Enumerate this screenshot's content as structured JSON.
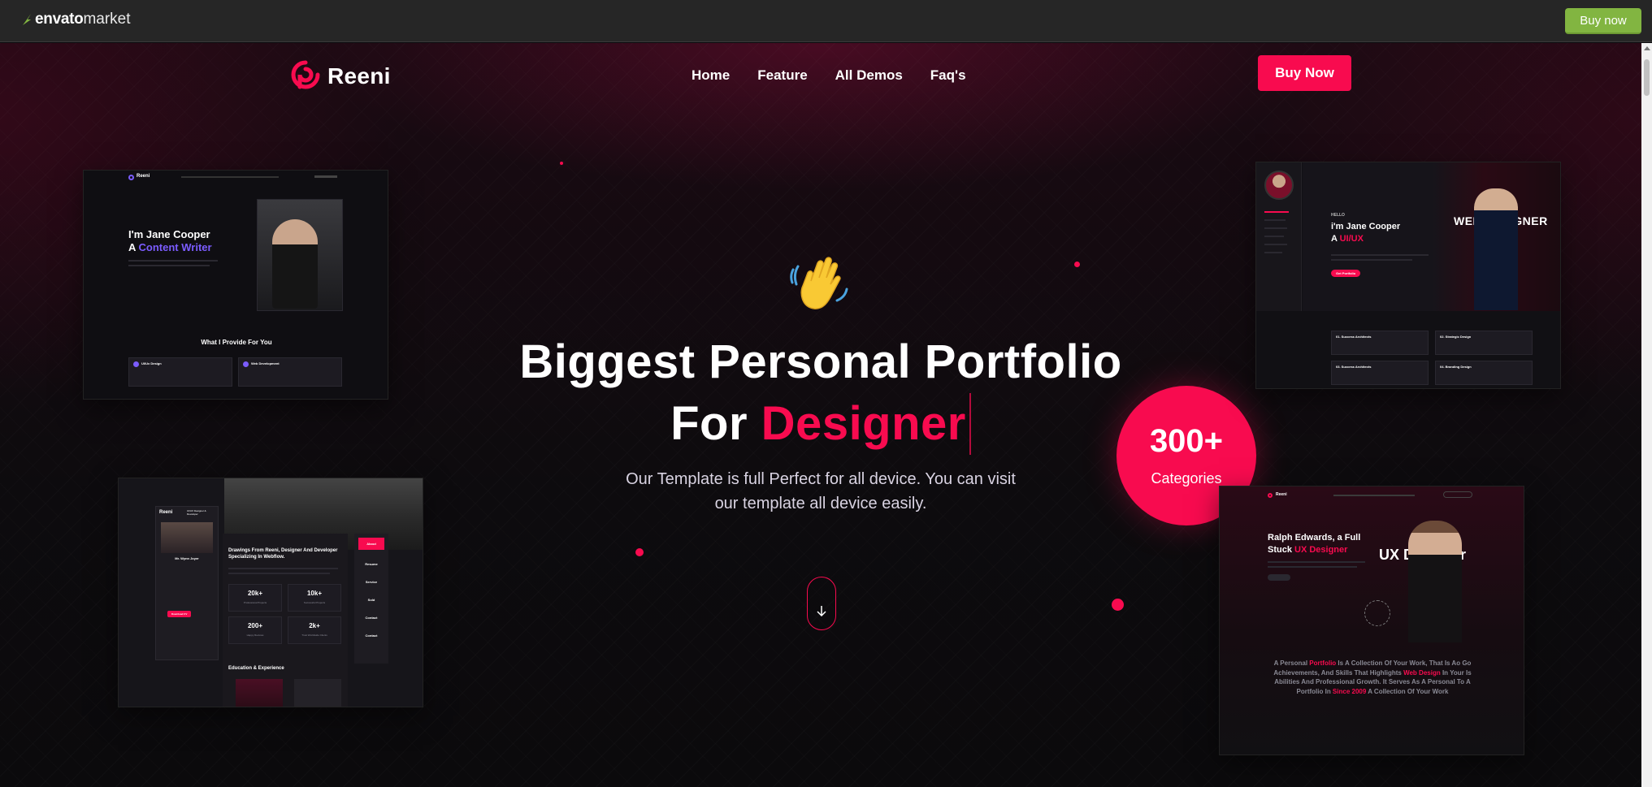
{
  "envato": {
    "logo_bold": "envato",
    "logo_light": "market",
    "buy_label": "Buy now"
  },
  "header": {
    "brand": "Reeni",
    "nav": [
      "Home",
      "Feature",
      "All Demos",
      "Faq's"
    ],
    "buy_label": "Buy Now"
  },
  "hero": {
    "title_line1": "Biggest Personal Portfolio",
    "title_line2_plain": "For ",
    "title_line2_accent": "Designer",
    "subtitle": "Our Template is full Perfect for all device. You can visit our template all device easily."
  },
  "badge": {
    "number": "300+",
    "label": "Categories"
  },
  "cards": {
    "card1": {
      "brand": "Reeni",
      "heading_plain": "I'm Jane Cooper",
      "heading_prefix": "A ",
      "heading_accent": "Content Writer",
      "section_title": "What I Provide For You",
      "services": [
        "UI/Ux Design",
        "Web Development"
      ]
    },
    "card2": {
      "greeting": "HELLO",
      "heading_plain": "i'm Jane Cooper",
      "heading_prefix": "A ",
      "heading_accent": "UI/UX",
      "button": "Get Portfolio",
      "overlay": "WEB DESIGNER",
      "services": [
        "01. Success Architects",
        "02. Strategic Design",
        "03. Success Architects",
        "04. Branding Design"
      ]
    },
    "card3": {
      "brand": "Reeni",
      "role": "UI/UX Designer & Developer",
      "name": "Mr. Wynn Joyer",
      "heading": "Drawings From Reeni, Designer And Developer Specializing In Webflow.",
      "stats": [
        {
          "value": "20k+",
          "label": "Professional Projects"
        },
        {
          "value": "10k+",
          "label": "Successful Projects"
        },
        {
          "value": "200+",
          "label": "Happy Reviews"
        },
        {
          "value": "2k+",
          "label": "Trust Worldwide Clients"
        }
      ],
      "side_menu": [
        "About",
        "Resume",
        "Service",
        "Sold",
        "Contact",
        "Contact"
      ],
      "section": "Education & Experience",
      "button": "Download CV"
    },
    "card4": {
      "brand": "Reeni",
      "heading_line1": "Ralph Edwards, a Full",
      "heading_line2_plain": "Stuck ",
      "heading_line2_accent": "UX Designer",
      "overlay": "UX Designer",
      "paragraph_parts": [
        "A Personal ",
        "Portfolio",
        " Is A Collection Of Your Work, That Is Ao Go Achievements, And Skills That Highlights ",
        "Web Design",
        " In Your Is Abilities And Professional Growth. It Serves As A Personal To A Portfolio In ",
        "Since 2009",
        " A Collection Of Your Work"
      ]
    }
  },
  "colors": {
    "accent": "#f80b4f",
    "envato_green": "#82b541",
    "purple": "#7b5cff"
  }
}
